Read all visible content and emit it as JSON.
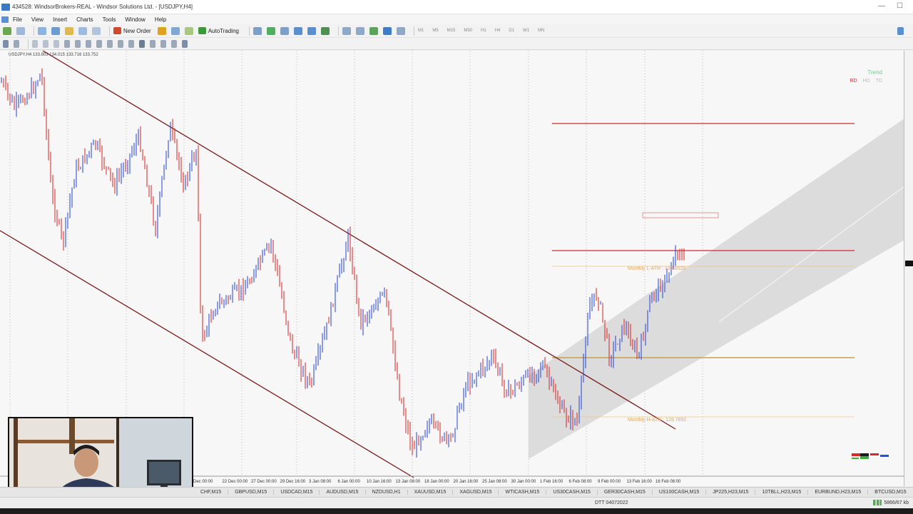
{
  "window": {
    "title": "434528: WindsorBrokers-REAL - Windsor Solutions Ltd. - [USDJPY,H4]",
    "minimize": "—",
    "maximize": "☐"
  },
  "menu": [
    "File",
    "View",
    "Insert",
    "Charts",
    "Tools",
    "Window",
    "Help"
  ],
  "toolbar": {
    "new_order": "New Order",
    "auto_trading": "AutoTrading",
    "timeframes": [
      "M1",
      "M5",
      "M15",
      "M30",
      "H1",
      "H4",
      "D1",
      "W1",
      "MN"
    ]
  },
  "chart": {
    "symbol_info": "USDJPY,H4 133.803 134.015 133.716 133.752",
    "date_labels": [
      "Dec 00:00",
      "22 Dec 00:00",
      "27 Dec 00:00",
      "29 Dec 16:00",
      "3 Jan 08:00",
      "6 Jan 00:00",
      "10 Jan 16:00",
      "13 Jan 08:00",
      "18 Jan 00:00",
      "20 Jan 16:00",
      "25 Jan 08:00",
      "30 Jan 00:00",
      "1 Feb 16:00",
      "6 Feb 08:00",
      "9 Feb 00:00",
      "13 Feb 16:00",
      "16 Feb 08:00"
    ],
    "monthly_low_atr": "Monthly L-ATR : 133.6528",
    "monthly_high_atr": "Monthly H-ATR : 128.7892",
    "trend_panel": {
      "title": "Trend",
      "codes": [
        "RD",
        "HD",
        "TD"
      ]
    },
    "colors": {
      "bull_candle": "#1f3fd6",
      "bear_candle": "#d62020",
      "channel_line": "#7a1a1a",
      "resistance": "#d42a2a",
      "support": "#c8a040",
      "atr_text": "#e0a860"
    }
  },
  "symbol_tabs": [
    "CHF,M15",
    "GBPUSD,M15",
    "USDCAD,M15",
    "AUDUSD,M15",
    "NZDUSD,H1",
    "XAUUSD,M15",
    "XAGUSD,M15",
    "WTICASH,M15",
    "US30CASH,M15",
    "GER30CASH,M15",
    "US100CASH,M15",
    "JP225,H23,M15",
    "10TBLL,H23,M15",
    "EURBUND,H23,M15",
    "BTCUSD,M15"
  ],
  "status": {
    "date": "DTT 04072022",
    "connection": "5866/67 kb"
  }
}
